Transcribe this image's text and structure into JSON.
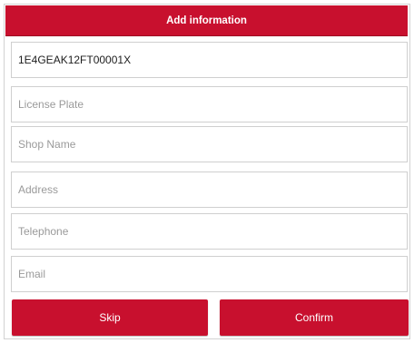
{
  "dialog": {
    "title": "Add information"
  },
  "fields": {
    "vin": {
      "value": "1E4GEAK12FT00001X",
      "placeholder": ""
    },
    "license_plate": {
      "value": "",
      "placeholder": "License Plate"
    },
    "shop_name": {
      "value": "",
      "placeholder": "Shop Name"
    },
    "address": {
      "value": "",
      "placeholder": "Address"
    },
    "telephone": {
      "value": "",
      "placeholder": "Telephone"
    },
    "email": {
      "value": "",
      "placeholder": "Email"
    }
  },
  "buttons": {
    "skip_label": "Skip",
    "confirm_label": "Confirm"
  },
  "colors": {
    "accent": "#c8102e",
    "border": "#cfcfcf",
    "placeholder_text": "#9a9a9a"
  }
}
